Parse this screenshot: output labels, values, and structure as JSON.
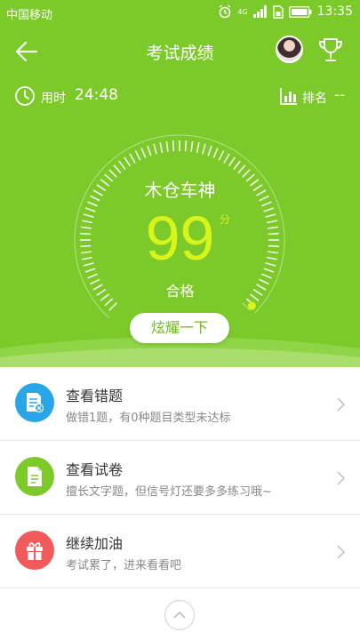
{
  "status_bar": {
    "carrier": "中国移动",
    "network": "4G",
    "clock": "13:35"
  },
  "header": {
    "title": "考试成绩",
    "back_icon": "arrow-left-icon",
    "trophy_icon": "trophy-icon"
  },
  "stats": {
    "time_label": "用时",
    "time_value": "24:48",
    "rank_label": "排名",
    "rank_value": "--"
  },
  "score_card": {
    "nickname": "木仓车神",
    "score": "99",
    "unit": "分",
    "result": "合格",
    "progress_fraction": 0.99,
    "share_button": "炫耀一下"
  },
  "colors": {
    "primary_green": "#7cc92a",
    "score_yellow": "#d8f51a",
    "icon_blue": "#29a6e8",
    "icon_green": "#7cc92a",
    "icon_red": "#f05a5a"
  },
  "menu": [
    {
      "title": "查看错题",
      "subtitle": "做错1题，有0种题目类型未达标",
      "icon": "wrong-questions-icon",
      "icon_color": "#29a6e8"
    },
    {
      "title": "查看试卷",
      "subtitle": "擅长文字题，但信号灯还要多多练习哦~",
      "icon": "document-icon",
      "icon_color": "#7cc92a"
    },
    {
      "title": "继续加油",
      "subtitle": "考试累了，进来看看吧",
      "icon": "gift-icon",
      "icon_color": "#f05a5a"
    }
  ],
  "bottom": {
    "icon": "chevron-up-icon"
  }
}
